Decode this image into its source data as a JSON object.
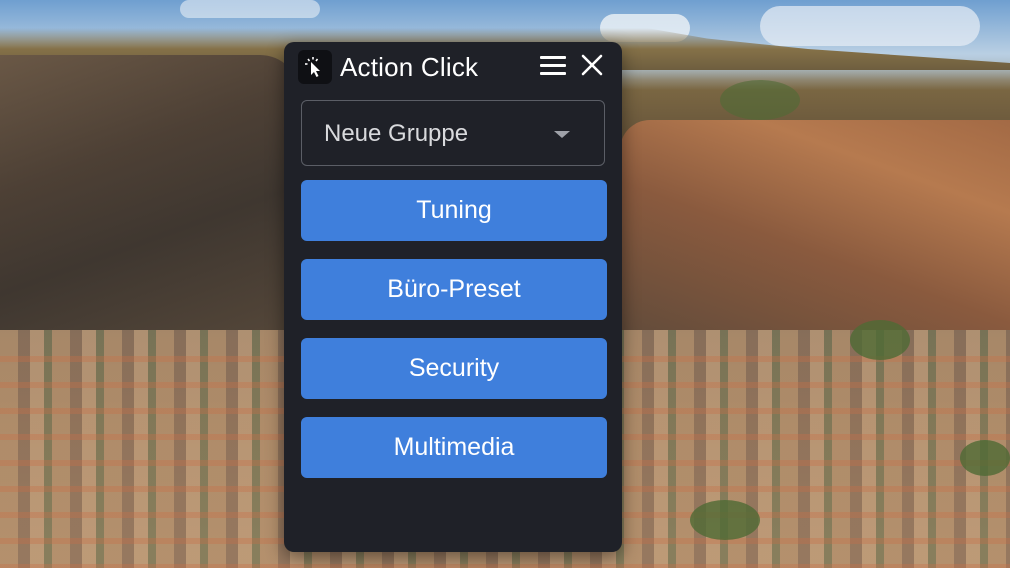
{
  "window": {
    "title": "Action Click",
    "icon": "cursor-click-icon",
    "menu_icon": "hamburger-menu-icon",
    "close_icon": "close-icon"
  },
  "group_select": {
    "value": "Neue Gruppe",
    "icon": "chevron-down-icon"
  },
  "actions": [
    {
      "label": "Tuning"
    },
    {
      "label": "Büro-Preset"
    },
    {
      "label": "Security"
    },
    {
      "label": "Multimedia"
    }
  ],
  "colors": {
    "panel_bg": "#1f2128",
    "button_bg": "#3f7fdc",
    "text": "#ffffff"
  }
}
